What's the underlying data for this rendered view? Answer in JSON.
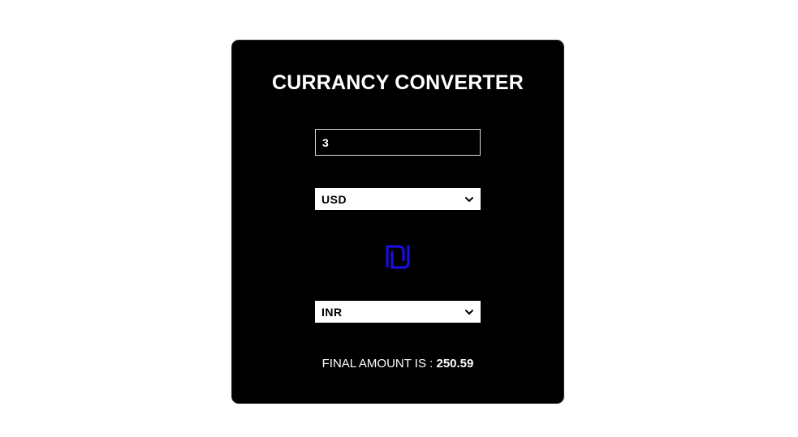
{
  "app": {
    "title": "CURRANCY CONVERTER"
  },
  "converter": {
    "amount_value": "3",
    "from_currency": "USD",
    "to_currency": "INR",
    "swap_icon": "shekel-swap-icon",
    "result_label": "FINAL AMOUNT IS : ",
    "result_value": "250.59"
  },
  "colors": {
    "card_background": "#000000",
    "page_background": "#ffffff",
    "swap_icon": "#1a0dde",
    "text": "#ffffff"
  }
}
